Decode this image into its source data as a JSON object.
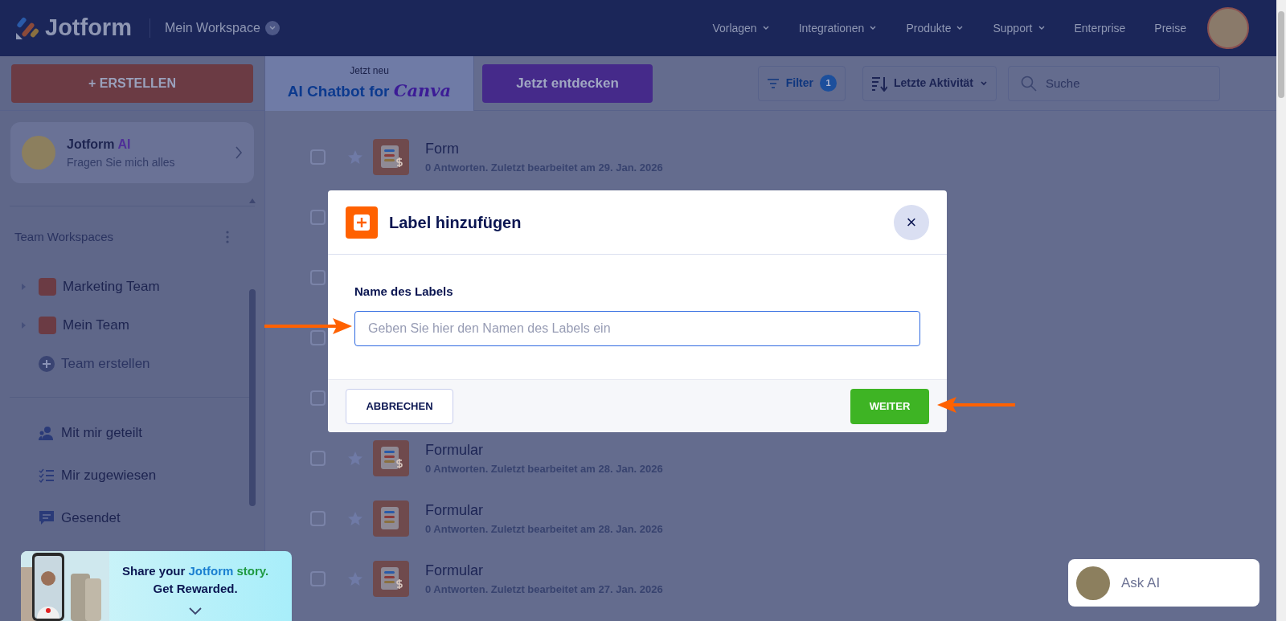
{
  "header": {
    "brand": "Jotform",
    "workspace": "Mein Workspace",
    "nav": [
      {
        "label": "Vorlagen",
        "dropdown": true
      },
      {
        "label": "Integrationen",
        "dropdown": true
      },
      {
        "label": "Produkte",
        "dropdown": true
      },
      {
        "label": "Support",
        "dropdown": true
      },
      {
        "label": "Enterprise",
        "dropdown": false
      },
      {
        "label": "Preise",
        "dropdown": false
      }
    ]
  },
  "toolbar": {
    "create": "+ ERSTELLEN",
    "promo_kicker": "Jetzt neu",
    "promo_title": "AI Chatbot for",
    "promo_brand": "Canva",
    "promo_button": "Jetzt entdecken",
    "filter": "Filter",
    "filter_count": "1",
    "sort": "Letzte Aktivität",
    "search_placeholder": "Suche"
  },
  "sidebar": {
    "ai_title": "Jotform",
    "ai_accent": "AI",
    "ai_subtitle": "Fragen Sie mich alles",
    "section": "Team Workspaces",
    "teams": [
      {
        "label": "Marketing Team",
        "expanded": false
      },
      {
        "label": "Mein Team",
        "expanded": false
      }
    ],
    "create_team": "Team erstellen",
    "links": [
      {
        "label": "Mit mir geteilt",
        "kind": "shared"
      },
      {
        "label": "Mir zugewiesen",
        "kind": "assigned"
      },
      {
        "label": "Gesendet",
        "kind": "sent"
      }
    ],
    "banner": {
      "line1": "Share your",
      "brand": "Jotform",
      "brand_tail": "story.",
      "line2": "Get Rewarded."
    }
  },
  "forms": [
    {
      "kind": "form",
      "title": "Form",
      "meta": "0 Antworten. Zuletzt bearbeitet am 29. Jan. 2026",
      "payment": true,
      "checked": false,
      "starred": false
    },
    {
      "kind": "covered",
      "checked": false
    },
    {
      "kind": "covered",
      "checked": false
    },
    {
      "kind": "covered",
      "checked": false
    },
    {
      "kind": "covered",
      "checked": false
    },
    {
      "kind": "form",
      "title": "Formular",
      "meta": "0 Antworten. Zuletzt bearbeitet am 28. Jan. 2026",
      "payment": true,
      "checked": false,
      "starred": false
    },
    {
      "kind": "form",
      "title": "Formular",
      "meta": "0 Antworten. Zuletzt bearbeitet am 28. Jan. 2026",
      "payment": false,
      "checked": false,
      "starred": false
    },
    {
      "kind": "form",
      "title": "Formular",
      "meta": "0 Antworten. Zuletzt bearbeitet am 27. Jan. 2026",
      "payment": true,
      "checked": false,
      "starred": false
    }
  ],
  "modal": {
    "title": "Label hinzufügen",
    "close": "×",
    "field_label": "Name des Labels",
    "placeholder": "Geben Sie hier den Namen des Labels ein",
    "cancel": "ABBRECHEN",
    "confirm": "WEITER"
  },
  "ask_ai": "Ask AI"
}
